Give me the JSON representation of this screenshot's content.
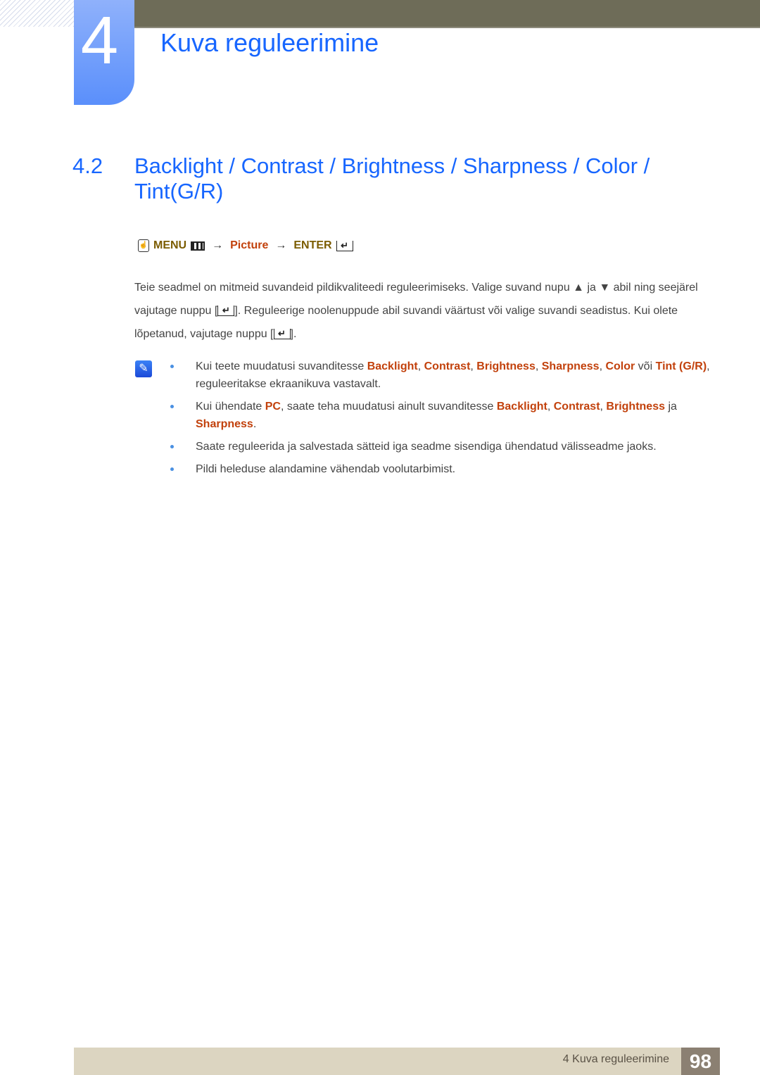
{
  "chapter": {
    "number": "4",
    "title": "Kuva reguleerimine"
  },
  "section": {
    "number": "4.2",
    "title": "Backlight / Contrast / Brightness / Sharpness / Color / Tint(G/R)"
  },
  "menu_path": {
    "menu": "MENU",
    "arrow": "→",
    "picture": "Picture",
    "enter": "ENTER"
  },
  "paragraph": {
    "part1": "Teie seadmel on mitmeid suvandeid pildikvaliteedi reguleerimiseks. Valige suvand nupu ▲ ja ▼ abil ning seejärel vajutage nuppu [",
    "part2": "]. Reguleerige noolenuppude abil suvandi väärtust või valige suvandi seadistus. Kui olete lõpetanud, vajutage nuppu [",
    "part3": "]."
  },
  "notes": [
    {
      "pre": "Kui teete muudatusi suvanditesse ",
      "b1": "Backlight",
      "s1": ", ",
      "b2": "Contrast",
      "s2": ", ",
      "b3": "Brightness",
      "s3": ", ",
      "b4": "Sharpness",
      "s4": ", ",
      "b5": "Color",
      "s5": " või ",
      "b6": "Tint (G/R)",
      "post": ", reguleeritakse ekraanikuva vastavalt."
    },
    {
      "pre": "Kui ühendate ",
      "b1": "PC",
      "s1": ", saate teha muudatusi ainult suvanditesse ",
      "b2": "Backlight",
      "s2": ", ",
      "b3": "Contrast",
      "s3": ", ",
      "b4": "Brightness",
      "s4": " ja ",
      "b5": "Sharpness",
      "post": "."
    },
    {
      "text": "Saate reguleerida ja salvestada sätteid iga seadme sisendiga ühendatud välisseadme jaoks."
    },
    {
      "text": "Pildi heleduse alandamine vähendab voolutarbimist."
    }
  ],
  "footer": {
    "chapter_label": "4 Kuva reguleerimine",
    "page_number": "98"
  }
}
